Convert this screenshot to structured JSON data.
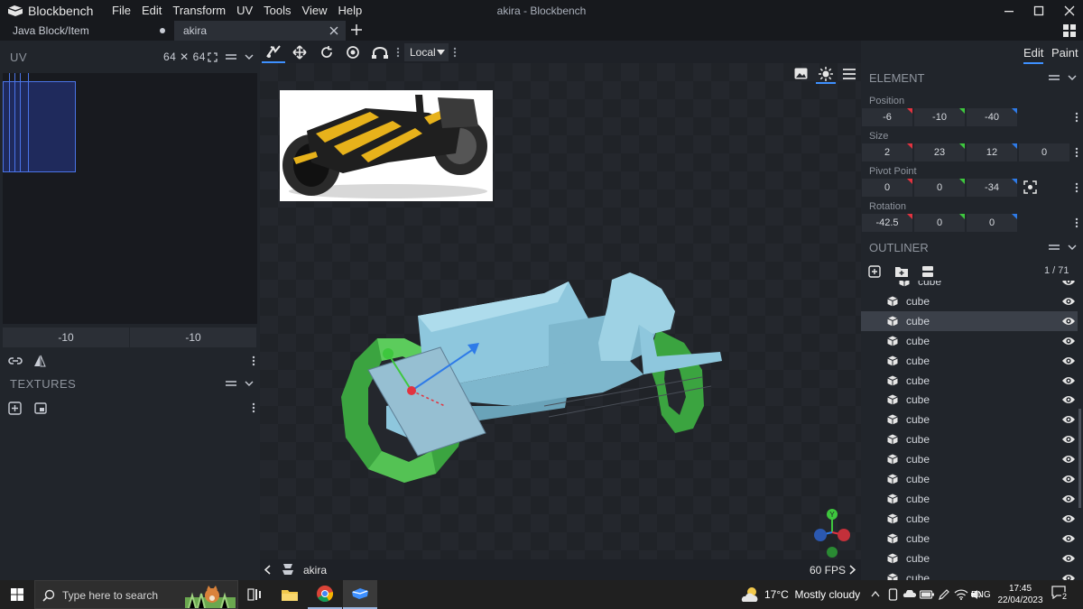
{
  "app": {
    "name": "Blockbench",
    "window_title": "akira - Blockbench",
    "menu": [
      "File",
      "Edit",
      "Transform",
      "UV",
      "Tools",
      "View",
      "Help"
    ]
  },
  "tabs": [
    {
      "label": "Java Block/Item"
    },
    {
      "label": "akira"
    }
  ],
  "uv_panel": {
    "title": "UV",
    "size": "64 ✕ 64",
    "fields": [
      "-10",
      "-10"
    ]
  },
  "textures_panel": {
    "title": "TEXTURES"
  },
  "toolbar": {
    "space_select": "Local"
  },
  "viewport": {
    "footer_name": "akira",
    "fps": "60 FPS",
    "axis_y": "Y"
  },
  "modes": {
    "edit": "Edit",
    "paint": "Paint"
  },
  "element_panel": {
    "title": "ELEMENT",
    "position_label": "Position",
    "position": [
      "-6",
      "-10",
      "-40"
    ],
    "size_label": "Size",
    "size": [
      "2",
      "23",
      "12",
      "0"
    ],
    "pivot_label": "Pivot Point",
    "pivot": [
      "0",
      "0",
      "-34"
    ],
    "rotation_label": "Rotation",
    "rotation": [
      "-42.5",
      "0",
      "0"
    ]
  },
  "outliner": {
    "title": "OUTLINER",
    "count": "1 / 71",
    "items": [
      "cube",
      "cube",
      "cube",
      "cube",
      "cube",
      "cube",
      "cube",
      "cube",
      "cube",
      "cube",
      "cube",
      "cube",
      "cube",
      "cube",
      "cube",
      "cube"
    ],
    "selected_index": 2
  },
  "colors": {
    "axis_x": "#e2333f",
    "axis_y": "#3ec73e",
    "axis_z": "#2e7be8",
    "accent": "#3e90ff",
    "model_body": "#8ec7dd",
    "wheel": "#58c454"
  },
  "taskbar": {
    "search_placeholder": "Type here to search",
    "weather": "17°C  Mostly cloudy",
    "language": "ENG",
    "time": "17:45",
    "date": "22/04/2023",
    "notifications": "2"
  }
}
